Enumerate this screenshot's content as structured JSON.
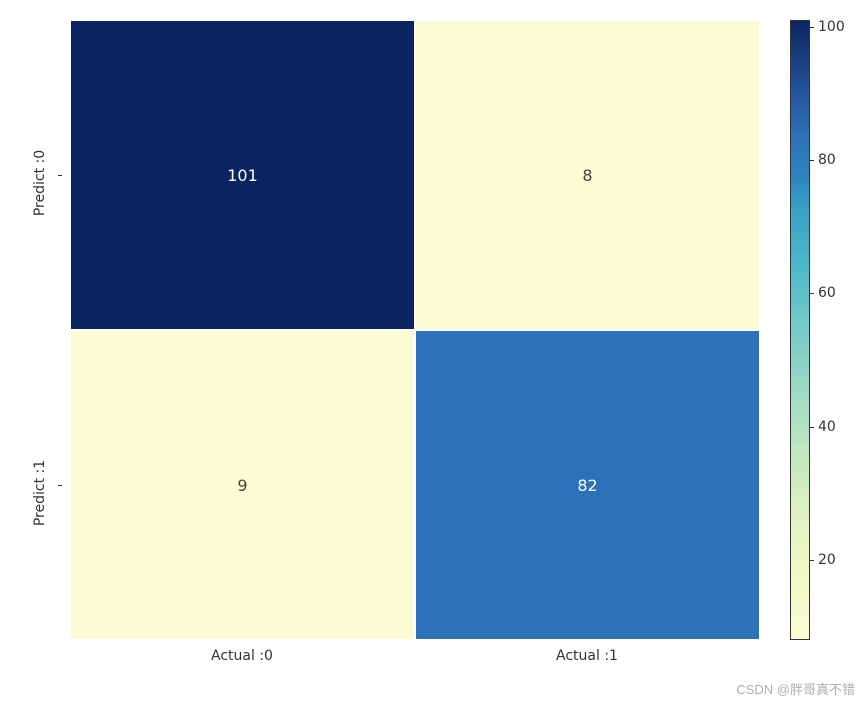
{
  "chart_data": {
    "type": "heatmap",
    "x_categories": [
      "Actual :0",
      "Actual :1"
    ],
    "y_categories": [
      "Predict :0",
      "Predict :1"
    ],
    "values": [
      [
        101,
        8
      ],
      [
        9,
        82
      ]
    ],
    "colorbar": {
      "range": [
        8,
        101
      ],
      "ticks": [
        20,
        40,
        60,
        80,
        100
      ]
    },
    "colormap": "YlGnBu"
  },
  "cells": {
    "c00": "101",
    "c01": "8",
    "c10": "9",
    "c11": "82"
  },
  "ylabels": {
    "l0": "Predict :0",
    "l1": "Predict :1"
  },
  "xlabels": {
    "l0": "Actual :0",
    "l1": "Actual :1"
  },
  "cbar_ticks": {
    "t100": "100",
    "t80": "80",
    "t60": "60",
    "t40": "40",
    "t20": "20"
  },
  "watermark": "CSDN @胖哥真不错"
}
